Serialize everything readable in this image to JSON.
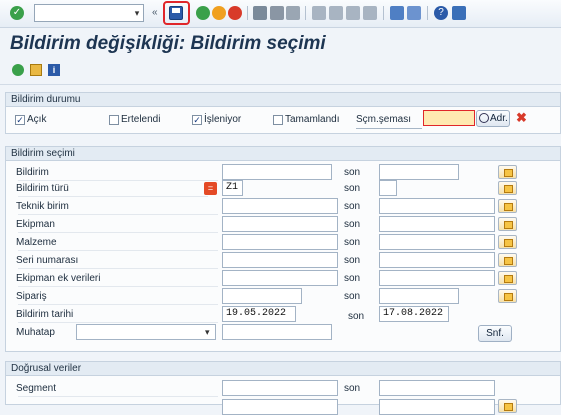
{
  "toolbar": {
    "command_field_value": "",
    "command_drop": "▾",
    "icons": [
      "enter-icon",
      "save-icon",
      "back-icon",
      "exit-icon",
      "cancel-icon",
      "print-icon",
      "find-icon",
      "find-next-icon",
      "first-page-icon",
      "previous-page-icon",
      "next-page-icon",
      "last-page-icon",
      "new-session-icon",
      "shortcut-icon",
      "help-icon",
      "customize-layout-icon"
    ],
    "colors": {
      "green": "#3aa04a",
      "orange": "#f0a020",
      "red": "#d83a2a",
      "blue": "#2b5aa8"
    }
  },
  "header": {
    "title": "Bildirim değişikliği: Bildirim seçimi"
  },
  "application_toolbar": {
    "icons": [
      "execute-icon",
      "get-variant-icon",
      "info-icon"
    ]
  },
  "status_group": {
    "title": "Bildirim durumu",
    "checkboxes": [
      {
        "label": "Açık",
        "checked": true
      },
      {
        "label": "Ertelendi",
        "checked": false
      },
      {
        "label": "İşleniyor",
        "checked": true
      },
      {
        "label": "Tamamlandı",
        "checked": false
      }
    ],
    "scheme_label": "Sçm.şeması",
    "scheme_value": "",
    "adr_button": "Adr.",
    "check_mark": "✓"
  },
  "selection_group": {
    "title": "Bildirim seçimi",
    "son": "son",
    "rows": [
      {
        "label": "Bildirim",
        "from": "",
        "to": ""
      },
      {
        "label": "Bildirim türü",
        "from": "Z1",
        "to": ""
      },
      {
        "label": "Teknik birim",
        "from": "",
        "to": ""
      },
      {
        "label": "Ekipman",
        "from": "",
        "to": ""
      },
      {
        "label": "Malzeme",
        "from": "",
        "to": ""
      },
      {
        "label": "Seri numarası",
        "from": "",
        "to": ""
      },
      {
        "label": "Ekipman ek verileri",
        "from": "",
        "to": ""
      },
      {
        "label": "Sipariş",
        "from": "",
        "to": ""
      },
      {
        "label": "Bildirim tarihi",
        "from": "19.05.2022",
        "to": "17.08.2022"
      }
    ],
    "partner_label": "Muhatap",
    "partner_role": "",
    "partner_value": "",
    "snf_button": "Snf."
  },
  "linear_group": {
    "title": "Doğrusal veriler",
    "segment_label": "Segment",
    "son": "son"
  }
}
